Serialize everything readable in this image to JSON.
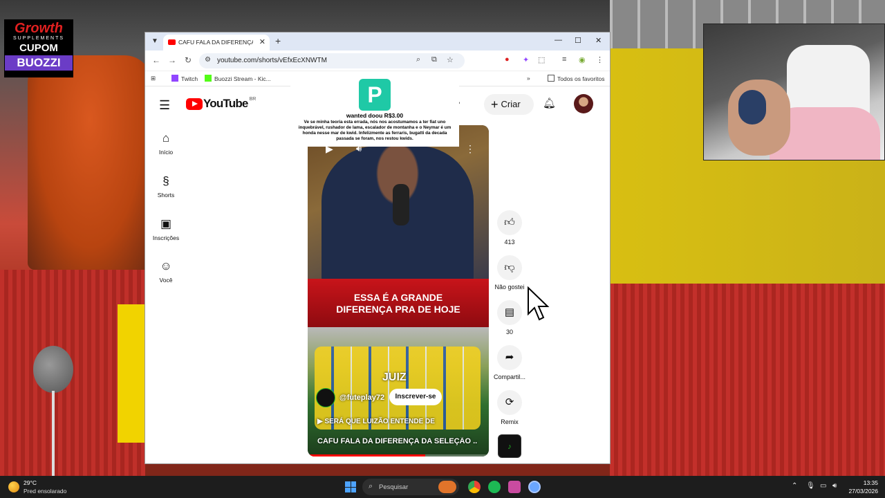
{
  "sponsor": {
    "brand": "Growth",
    "brand_sub": "SUPPLEMENTS",
    "cupom": "CUPOM",
    "code": "BUOZZI"
  },
  "browser": {
    "tab_title": "CAFU FALA DA DIFERENÇA DA",
    "url": "youtube.com/shorts/vEfxEcXNWTM",
    "bookmarks": [
      "Twitch",
      "Buozzi Stream - Kic...",
      "Todos os favoritos"
    ]
  },
  "youtube": {
    "logo_text": "YouTube",
    "country": "BR",
    "create_label": "Criar",
    "nav": [
      {
        "label": "Início",
        "icon": "home-icon"
      },
      {
        "label": "Shorts",
        "icon": "shorts-icon"
      },
      {
        "label": "Inscrições",
        "icon": "subscriptions-icon"
      },
      {
        "label": "Você",
        "icon": "you-icon"
      }
    ],
    "short": {
      "banner_line1": "ESSA É A GRANDE",
      "banner_line2": "DIFERENÇA PRA DE HOJE",
      "overlay_word": "JUIZ",
      "channel": "@futeplay72",
      "subscribe_label": "Inscrever-se",
      "playlist": "SERÁ QUE LUIZÃO ENTENDE DE",
      "title": "CAFU FALA DA DIFERENÇA DA SELEÇÃO ...",
      "progress": 0.65
    },
    "actions": {
      "like_count": "413",
      "dislike_label": "Não gostei",
      "comment_count": "30",
      "share_label": "Compartil...",
      "remix_label": "Remix"
    }
  },
  "donation": {
    "who": "wanted doou R$3.00",
    "message": "Ve se minha teoria esta errada, nós nos acostumamos a ter fiat uno inquebrável, rushador de lama, escalador de montanha e o Neymar é um honda nesse mar de kwid. Infelizmente as ferraris, bugatti da decada passada se foram, nos restou kwids."
  },
  "taskbar": {
    "temp": "29°C",
    "weather": "Pred ensolarado",
    "search_label": "Pesquisar",
    "time": "13:35",
    "date": "27/03/2026"
  },
  "colors": {
    "youtube_red": "#ff0000",
    "taskbar": "#1d1d1d",
    "tab_bar": "#dfe7f5"
  }
}
